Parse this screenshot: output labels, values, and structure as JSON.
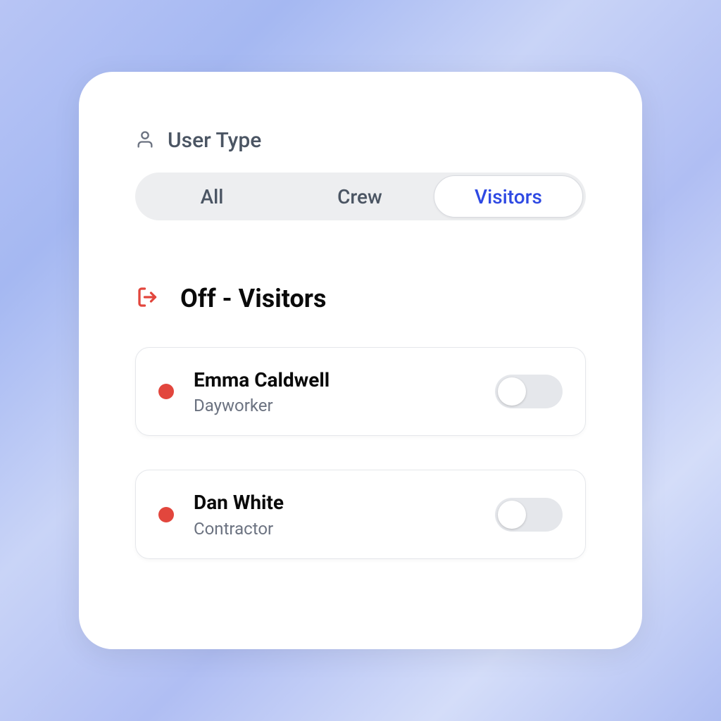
{
  "header": {
    "title": "User Type"
  },
  "tabs": [
    {
      "label": "All",
      "active": false
    },
    {
      "label": "Crew",
      "active": false
    },
    {
      "label": "Visitors",
      "active": true
    }
  ],
  "section": {
    "title": "Off - Visitors",
    "icon": "logout-icon",
    "icon_color": "#e2463d"
  },
  "visitors": [
    {
      "name": "Emma Caldwell",
      "role": "Dayworker",
      "status_color": "#e2463d",
      "toggle_on": false
    },
    {
      "name": "Dan White",
      "role": "Contractor",
      "status_color": "#e2463d",
      "toggle_on": false
    }
  ],
  "colors": {
    "accent": "#2e49e3",
    "danger": "#e2463d"
  }
}
